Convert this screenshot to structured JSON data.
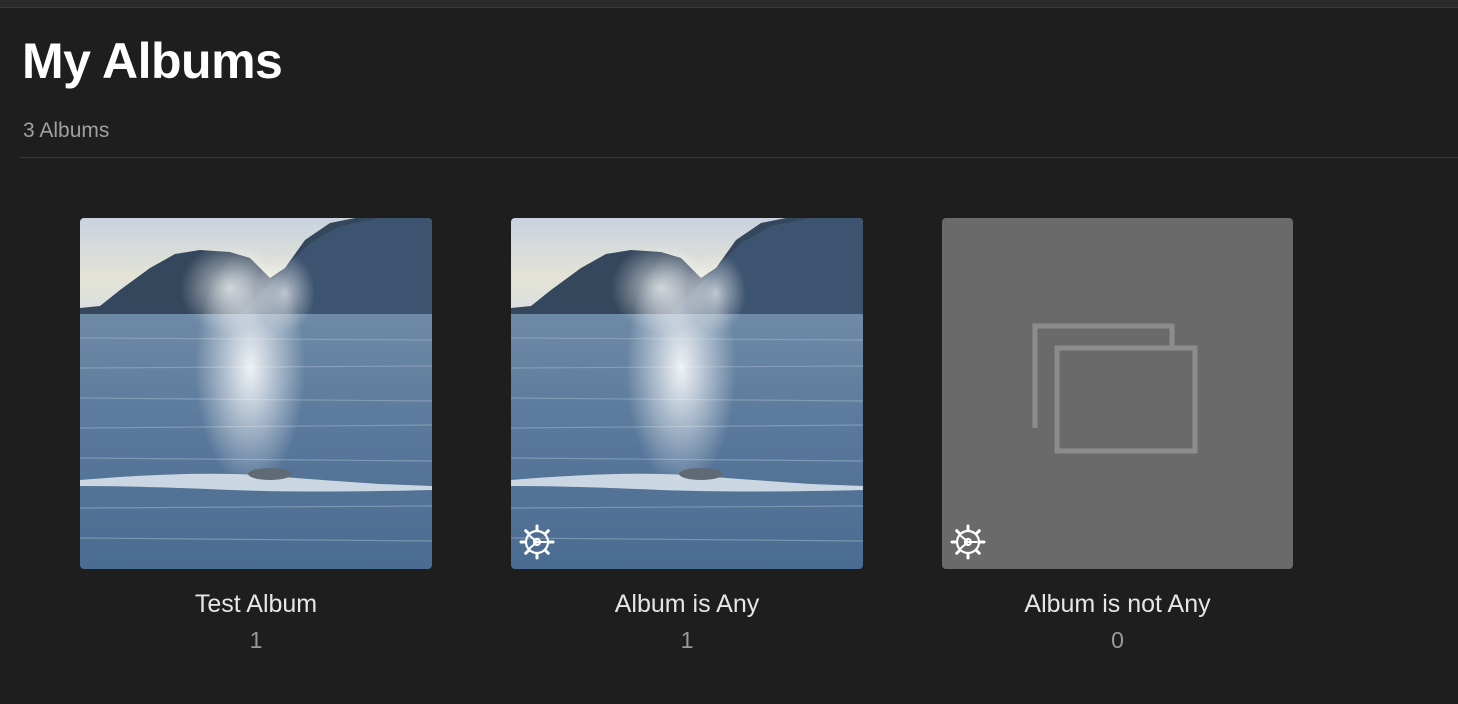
{
  "header": {
    "title": "My Albums",
    "subtitle": "3 Albums"
  },
  "albums": [
    {
      "name": "Test Album",
      "count": "1",
      "thumbnail": "whale-spout-photo",
      "smart": false
    },
    {
      "name": "Album is Any",
      "count": "1",
      "thumbnail": "whale-spout-photo",
      "smart": true,
      "badge_icon": "gear-icon"
    },
    {
      "name": "Album is not Any",
      "count": "0",
      "thumbnail": "empty-album-placeholder",
      "smart": true,
      "badge_icon": "gear-icon"
    }
  ],
  "colors": {
    "background": "#1e1e1e",
    "placeholder": "#6a6a6a",
    "title": "#ffffff",
    "muted": "#a0a0a0"
  }
}
